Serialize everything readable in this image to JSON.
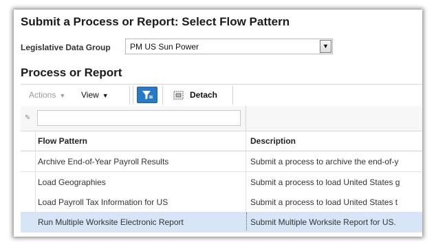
{
  "page": {
    "title": "Submit a Process or Report: Select Flow Pattern"
  },
  "ldg": {
    "label": "Legislative Data Group",
    "value": "PM US Sun Power"
  },
  "section": {
    "title": "Process or Report"
  },
  "toolbar": {
    "actions_label": "Actions",
    "view_label": "View",
    "detach_label": "Detach"
  },
  "table": {
    "columns": [
      "Flow Pattern",
      "Description"
    ],
    "rows": [
      [
        "Archive End-of-Year Payroll Results",
        "Submit a process to archive the end-of-y"
      ],
      [
        "Load Geographies",
        "Submit a process to load United States g"
      ],
      [
        "Load Payroll Tax Information for US",
        "Submit a process to load United States t"
      ],
      [
        "Run Multiple Worksite Electronic Report",
        "Submit Multiple Worksite Report for US."
      ]
    ],
    "selected_row": 3
  },
  "colors": {
    "selected_row_bg": "#d7e6f6",
    "filter_button_bg": "#2979c9"
  },
  "icons": {
    "dropdown": "chevron-down-icon",
    "filter": "filter-icon",
    "detach": "detach-icon",
    "edit": "pencil-icon"
  }
}
